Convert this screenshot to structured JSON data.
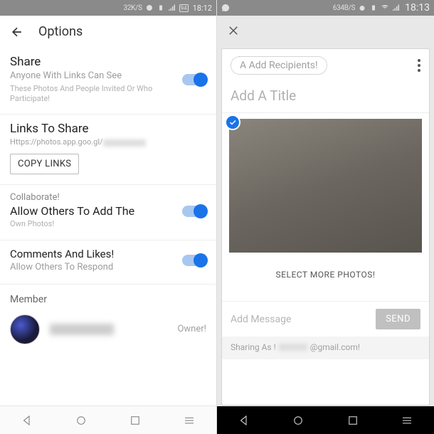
{
  "left": {
    "status": {
      "speed": "32K/S",
      "battery": "94",
      "time": "18:12"
    },
    "header": {
      "title": "Options"
    },
    "share": {
      "title": "Share",
      "subtitle": "Anyone With Links Can See",
      "note": "These Photos And People Invited Or Who Participate!"
    },
    "links": {
      "title": "Links To Share",
      "url_prefix": "Https://photos.app.goo.gl/",
      "copy_label": "COPY LINKS"
    },
    "collab": {
      "title": "Collaborate!",
      "subtitle": "Allow Others To Add The",
      "note": "Own Photos!"
    },
    "comments": {
      "title": "Comments And Likes!",
      "subtitle": "Allow Others To Respond"
    },
    "member": {
      "heading": "Member",
      "role": "Owner!"
    }
  },
  "right": {
    "status": {
      "speed": "634B/S",
      "time": "18:13"
    },
    "recipients_placeholder": "A Add Recipients!",
    "title_placeholder": "Add A Title",
    "select_more": "SELECT MORE PHOTOS!",
    "message_placeholder": "Add Message",
    "send_label": "SEND",
    "sharing_as_label": "Sharing As !",
    "sharing_suffix": "@gmail.com!"
  }
}
